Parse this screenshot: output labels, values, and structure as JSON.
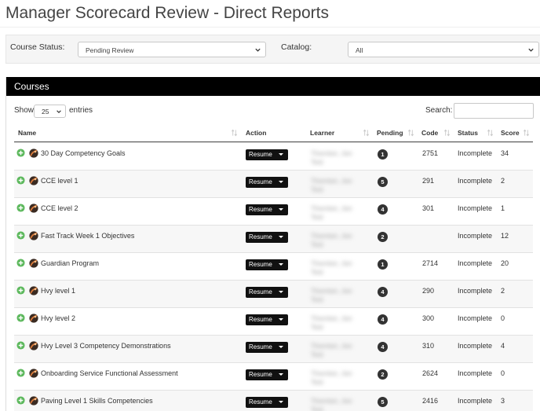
{
  "page": {
    "title": "Manager Scorecard Review - Direct Reports"
  },
  "filters": {
    "course_status": {
      "label": "Course Status:",
      "value": "Pending Review"
    },
    "catalog": {
      "label": "Catalog:",
      "value": "All"
    }
  },
  "panel": {
    "title": "Courses"
  },
  "table_controls": {
    "show_label": "Show",
    "entries_value": "25",
    "entries_label": "entries",
    "search_label": "Search:",
    "search_value": ""
  },
  "columns": {
    "name": "Name",
    "action": "Action",
    "learner": "Learner",
    "pending": "Pending",
    "code": "Code",
    "status": "Status",
    "score": "Score"
  },
  "action_label": "Resume",
  "learner_redacted": [
    "Thornton, Jon",
    "Test"
  ],
  "rows": [
    {
      "name": "30 Day Competency Goals",
      "pending": "1",
      "code": "2751",
      "status": "Incomplete",
      "score": "34"
    },
    {
      "name": "CCE level 1",
      "pending": "5",
      "code": "291",
      "status": "Incomplete",
      "score": "2"
    },
    {
      "name": "CCE level 2",
      "pending": "4",
      "code": "301",
      "status": "Incomplete",
      "score": "1"
    },
    {
      "name": "Fast Track Week 1 Objectives",
      "pending": "2",
      "code": "",
      "status": "Incomplete",
      "score": "12"
    },
    {
      "name": "Guardian Program",
      "pending": "1",
      "code": "2714",
      "status": "Incomplete",
      "score": "20"
    },
    {
      "name": "Hvy level 1",
      "pending": "4",
      "code": "290",
      "status": "Incomplete",
      "score": "2"
    },
    {
      "name": "Hvy level 2",
      "pending": "4",
      "code": "300",
      "status": "Incomplete",
      "score": "0"
    },
    {
      "name": "Hvy Level 3 Competency Demonstrations",
      "pending": "4",
      "code": "310",
      "status": "Incomplete",
      "score": "4"
    },
    {
      "name": "Onboarding Service Functional Assessment",
      "pending": "2",
      "code": "2624",
      "status": "Incomplete",
      "score": "0"
    },
    {
      "name": "Paving Level 1 Skills Competencies",
      "pending": "5",
      "code": "2416",
      "status": "Incomplete",
      "score": "3"
    }
  ],
  "colors": {
    "header_bg": "#000000",
    "badge_bg": "#333333",
    "plus_green": "#5cb85c",
    "row_alt": "#f7f7f7"
  },
  "icons": {
    "expand": "plus-circle-icon",
    "course": "course-thumbnail-icon",
    "sort": "sort-arrows-icon",
    "dropdown": "chevron-down-icon"
  }
}
